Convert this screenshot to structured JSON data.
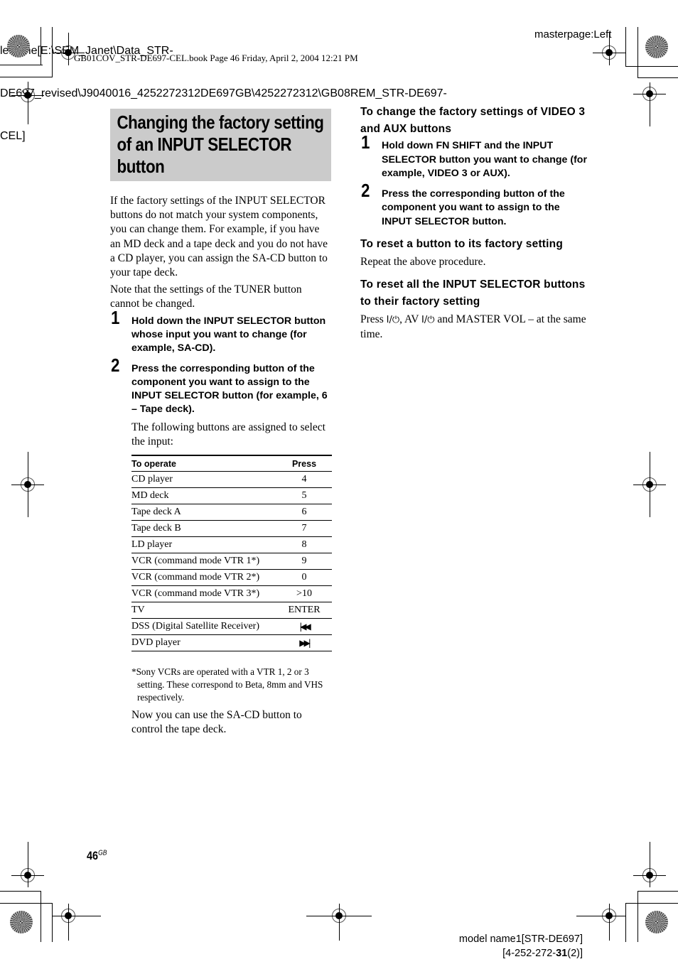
{
  "header": {
    "filename_lines": [
      "lename[E:\\SEM_Janet\\Data_STR-",
      "DE697_revised\\J9040016_4252272312DE697GB\\4252272312\\GB08REM_STR-DE697-",
      "CEL]"
    ],
    "book_info": "GB01COV_STR-DE697-CEL.book  Page 46  Friday, April 2, 2004  12:21 PM",
    "masterpage": "masterpage:Left"
  },
  "title": "Changing the factory setting of an INPUT SELECTOR button",
  "left": {
    "intro": "If the factory settings of the INPUT SELECTOR buttons do not match your system components, you can change them. For example, if you have an MD deck and a tape deck and you do not have a CD player, you can assign the SA-CD button to your tape deck.",
    "note": "Note that the settings of the TUNER button cannot be changed.",
    "steps": [
      {
        "num": "1",
        "text": "Hold down the INPUT SELECTOR button whose input you want to change (for example, SA-CD)."
      },
      {
        "num": "2",
        "text": "Press the corresponding button of the component you want to assign to the INPUT SELECTOR button (for example, 6 – Tape deck)."
      }
    ],
    "table_intro": "The following buttons are assigned to select the input:",
    "table": {
      "headers": [
        "To operate",
        "Press"
      ],
      "rows": [
        [
          "CD player",
          "4"
        ],
        [
          "MD deck",
          "5"
        ],
        [
          "Tape deck A",
          "6"
        ],
        [
          "Tape deck B",
          "7"
        ],
        [
          "LD player",
          "8"
        ],
        [
          "VCR (command mode VTR 1*)",
          "9"
        ],
        [
          "VCR (command mode VTR 2*)",
          "0"
        ],
        [
          "VCR (command mode VTR 3*)",
          ">10"
        ],
        [
          "TV",
          "ENTER"
        ],
        [
          "DSS (Digital Satellite Receiver)",
          "⏮ (previous-track icon)"
        ],
        [
          "DVD player",
          "⏭ (next-track icon)"
        ]
      ],
      "row_glyphs": {
        "9": "|◀◀",
        "10": "▶▶|"
      }
    },
    "footnote": "*Sony VCRs are operated with a VTR 1, 2 or 3 setting. These correspond to Beta, 8mm and VHS respectively.",
    "closing": "Now you can use the SA-CD button to control the tape deck."
  },
  "right": {
    "section1": {
      "heading": "To change the factory settings of VIDEO 3 and AUX buttons",
      "steps": [
        {
          "num": "1",
          "text": "Hold down FN SHIFT and the INPUT SELECTOR button you want to change (for example, VIDEO 3 or AUX)."
        },
        {
          "num": "2",
          "text": "Press the corresponding button of the component you want to assign to the INPUT SELECTOR button."
        }
      ]
    },
    "section2": {
      "heading": "To reset a button to its factory setting",
      "body": "Repeat the above procedure."
    },
    "section3": {
      "heading": "To reset all the INPUT SELECTOR buttons to their factory setting",
      "body_parts": [
        "Press ",
        "I/⏻",
        ", AV ",
        "I/⏻",
        " and MASTER VOL – at the same time."
      ]
    }
  },
  "footer": {
    "page_number": "46",
    "page_suffix": "GB",
    "model_line1": "model name1[STR-DE697]",
    "model_line2_pre": "[4-252-272-",
    "model_line2_bold": "31",
    "model_line2_post": "(2)]"
  },
  "colors": {
    "title_band": "#cbcbcb"
  }
}
